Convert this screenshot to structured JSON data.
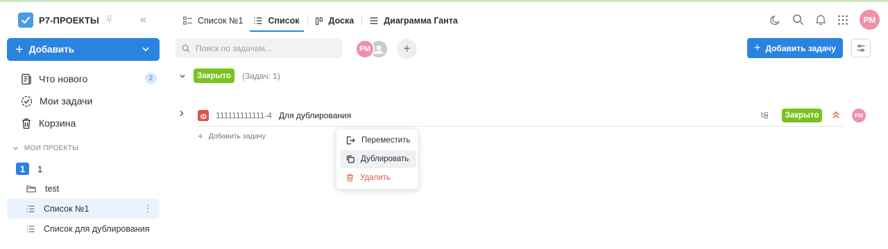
{
  "app": {
    "name": "Р7-ПРОЕКТЫ"
  },
  "sidebar": {
    "add_label": "Добавить",
    "nav": [
      {
        "label": "Что нового",
        "badge": "2"
      },
      {
        "label": "Мои задачи"
      },
      {
        "label": "Корзина"
      }
    ],
    "section_label": "МОИ ПРОЕКТЫ",
    "project": {
      "number": "1",
      "name": "1"
    },
    "tree": [
      {
        "label": "test"
      },
      {
        "label": "Список №1"
      },
      {
        "label": "Список для дублирования"
      }
    ]
  },
  "tabs": [
    {
      "label": "Список №1"
    },
    {
      "label": "Список"
    },
    {
      "label": "Доска"
    },
    {
      "label": "Диаграмма Ганта"
    }
  ],
  "user": {
    "initials": "РМ"
  },
  "toolbar": {
    "search_placeholder": "Поиск по задачам...",
    "member_initials": "РМ",
    "add_task_label": "Добавить задачу"
  },
  "group": {
    "status": "Закрыто",
    "count": "(Задач: 1)"
  },
  "task": {
    "id": "111111111111-4",
    "name": "Для дублирования",
    "status": "Закрыто",
    "assignee": "РМ"
  },
  "add_subtask_label": "Добавить задачу",
  "context_menu": {
    "items": [
      {
        "label": "Переместить"
      },
      {
        "label": "Дублировать"
      },
      {
        "label": "Удалить"
      }
    ]
  },
  "colors": {
    "accent": "#2b83e0",
    "status_closed": "#7ac21e",
    "avatar": "#ee90a9",
    "danger": "#e0594e"
  }
}
